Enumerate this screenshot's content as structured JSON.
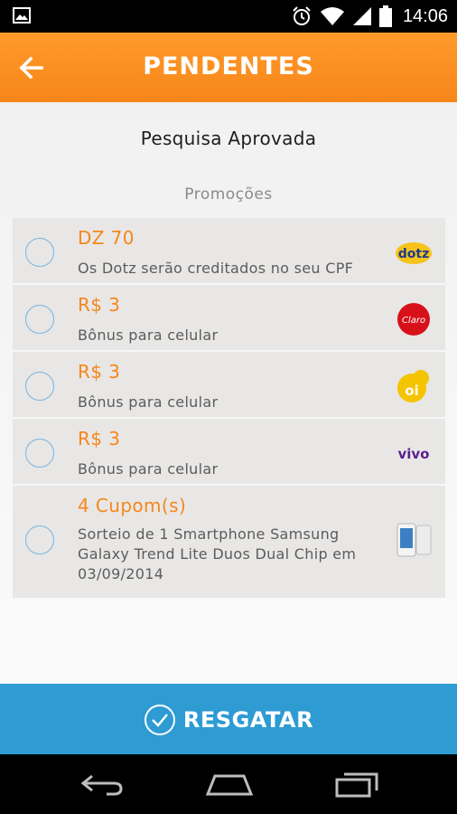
{
  "status_bar": {
    "time": "14:06",
    "icons": [
      "image-icon",
      "alarm-icon",
      "wifi-icon",
      "signal-icon",
      "battery-icon"
    ]
  },
  "app_bar": {
    "title": "PENDENTES",
    "back_icon": "arrow-left-icon"
  },
  "content": {
    "heading": "Pesquisa Aprovada",
    "section_label": "Promoções",
    "items": [
      {
        "value": "DZ 70",
        "description": "Os Dotz serão creditados no seu CPF",
        "logo": "dotz",
        "logo_text": "dotz"
      },
      {
        "value": "R$ 3",
        "description": "Bônus para celular",
        "logo": "claro",
        "logo_text": "Claro"
      },
      {
        "value": "R$ 3",
        "description": "Bônus para celular",
        "logo": "oi",
        "logo_text": "oi"
      },
      {
        "value": "R$ 3",
        "description": "Bônus para celular",
        "logo": "vivo",
        "logo_text": "vivo"
      },
      {
        "value": "4 Cupom(s)",
        "description": "Sorteio de 1 Smartphone Samsung Galaxy Trend Lite Duos Dual Chip  em 03/09/2014",
        "logo": "smartphone-image"
      }
    ]
  },
  "action_button": {
    "label": "RESGATAR",
    "icon": "check-circle-icon"
  },
  "nav_bar": {
    "buttons": [
      "back-nav-icon",
      "home-nav-icon",
      "recents-nav-icon"
    ]
  },
  "colors": {
    "app_bar": "#f7861a",
    "accent_text": "#f7861a",
    "action_button": "#2e9bd3",
    "radio_border": "#7ab3dd"
  }
}
